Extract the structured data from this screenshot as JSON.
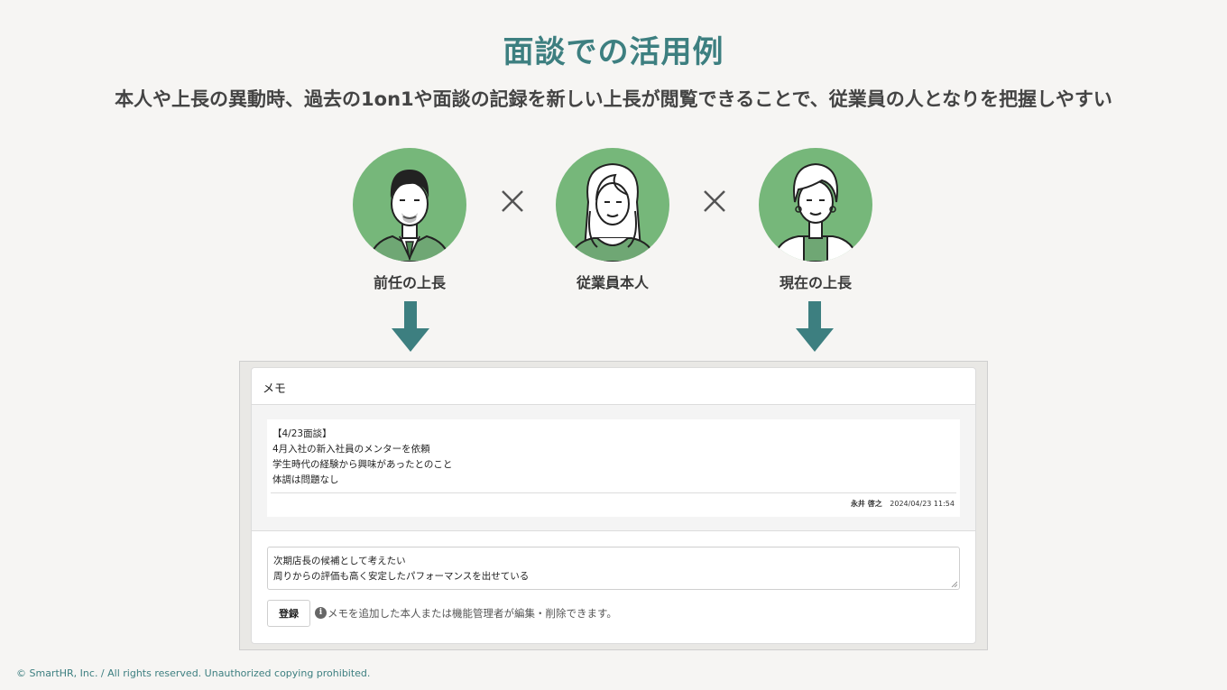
{
  "title": "面談での活用例",
  "subtitle": "本人や上長の異動時、過去の1on1や面談の記録を新しい上長が閲覧できることで、従業員の人となりを把握しやすい",
  "people": [
    {
      "label": "前任の上長",
      "icon": "male-manager-icon"
    },
    {
      "label": "従業員本人",
      "icon": "female-employee-icon"
    },
    {
      "label": "現在の上長",
      "icon": "female-manager-icon"
    }
  ],
  "colors": {
    "accent": "#3d7f80",
    "avatar_bg": "#76b77a",
    "page_bg": "#f6f5f3"
  },
  "memo_panel": {
    "header": "メモ",
    "entry": {
      "lines": [
        "【4/23面談】",
        "4月入社の新入社員のメンターを依頼",
        "学生時代の経験から興味があったとのこと",
        "体調は問題なし"
      ],
      "author": "永井 啓之",
      "timestamp": "2024/04/23 11:54"
    },
    "input_lines": [
      "次期店長の候補として考えたい",
      "周りからの評価も高く安定したパフォーマンスを出せている"
    ],
    "submit_label": "登録",
    "hint": "メモを追加した本人または機能管理者が編集・削除できます。"
  },
  "footer": "© SmartHR, Inc. / All rights reserved. Unauthorized copying prohibited."
}
